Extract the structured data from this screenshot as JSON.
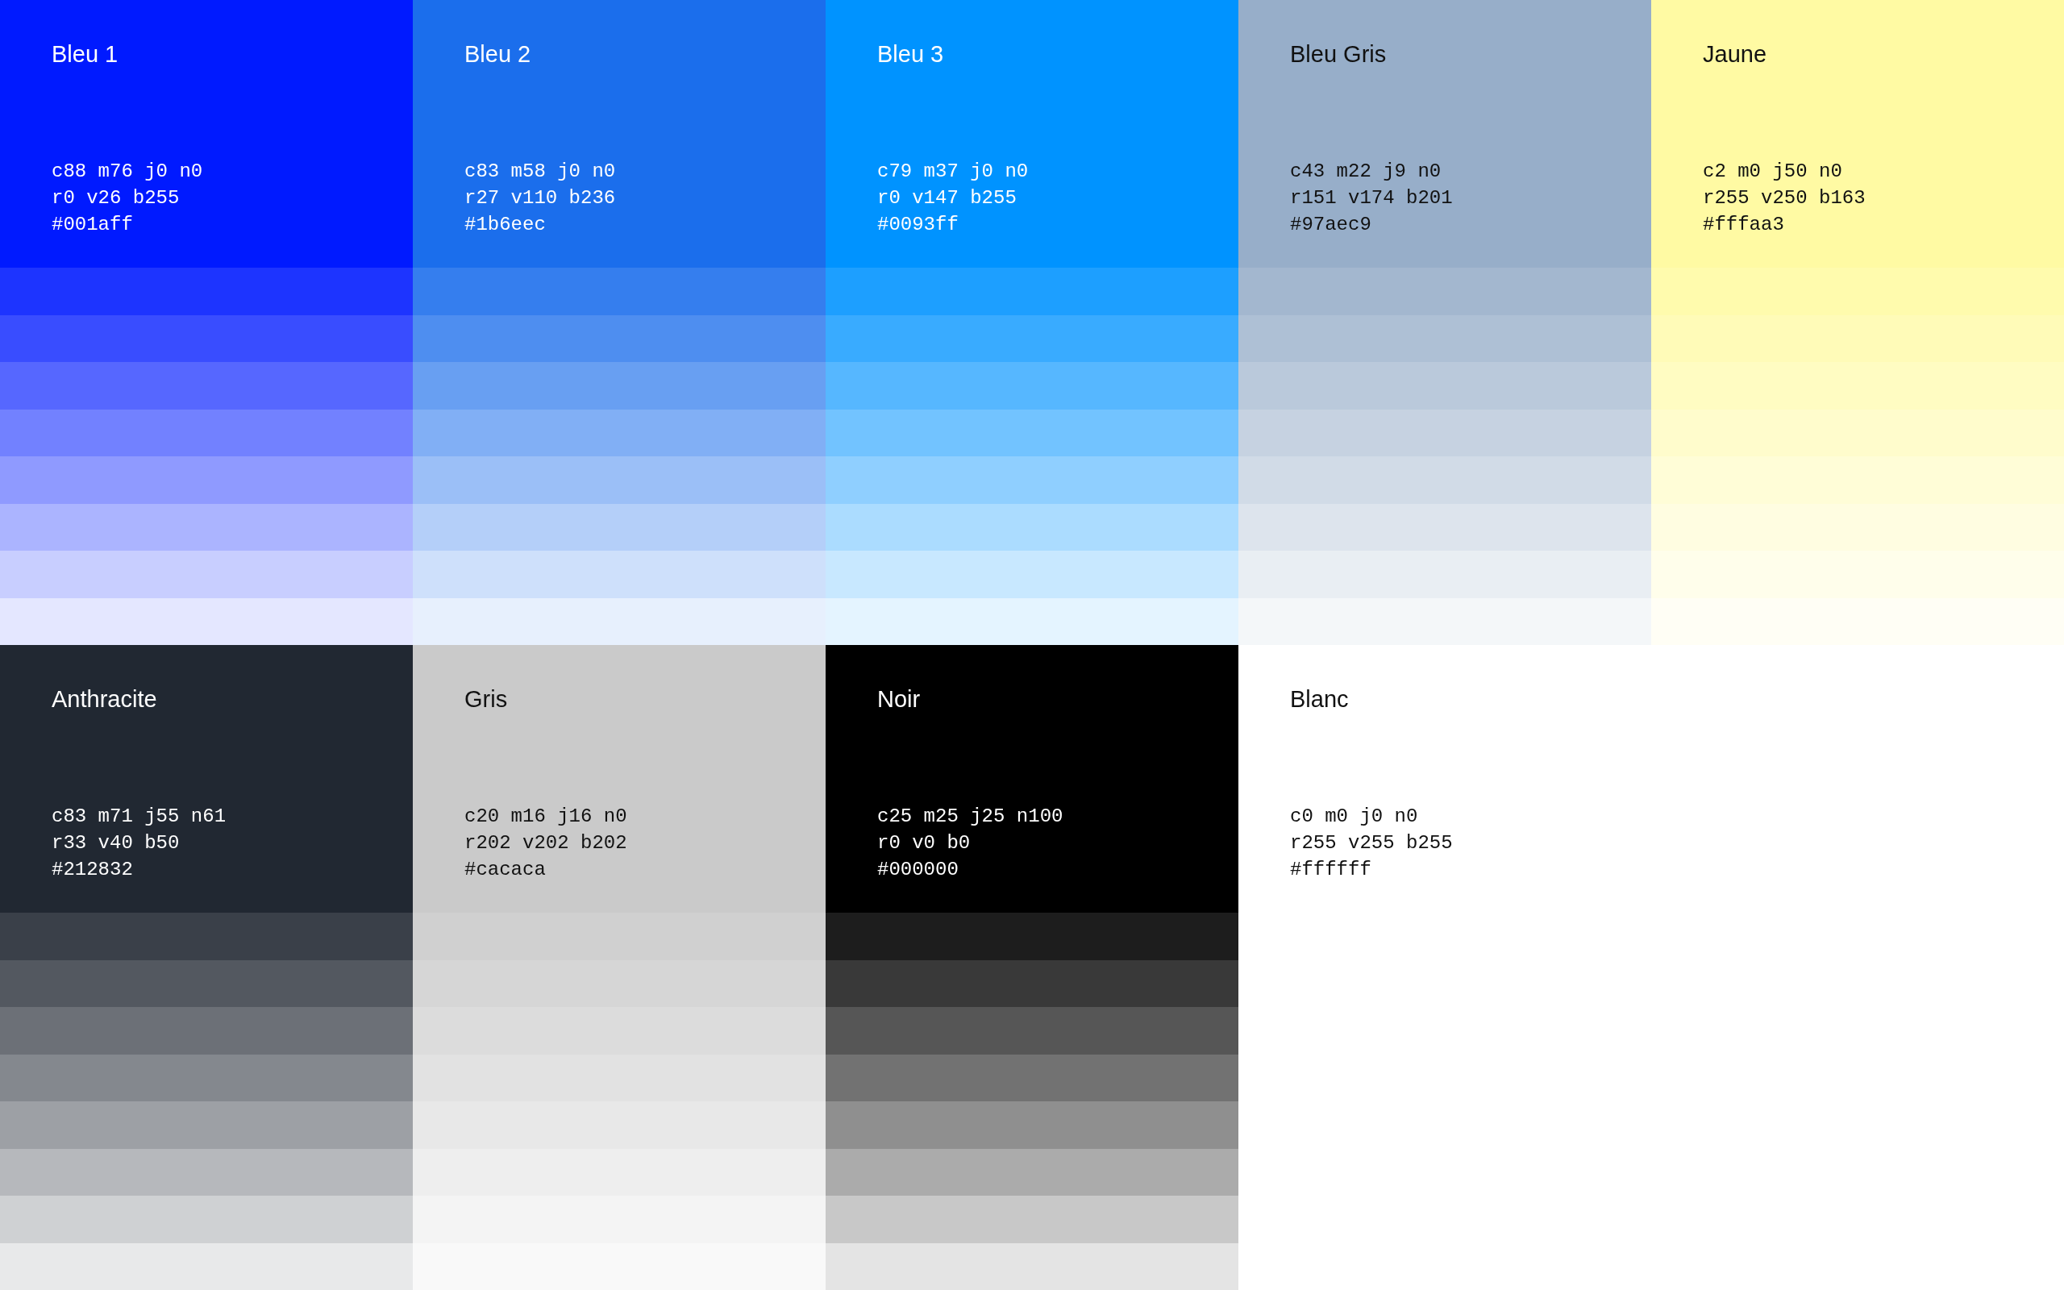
{
  "palette": {
    "rows": [
      [
        {
          "name": "Bleu 1",
          "color": "#001aff",
          "cmjn": "c88 m76 j0 n0",
          "rvb": "r0 v26 b255",
          "hex": "#001aff"
        },
        {
          "name": "Bleu 2",
          "color": "#1b6eec",
          "cmjn": "c83 m58 j0 n0",
          "rvb": "r27 v110 b236",
          "hex": "#1b6eec"
        },
        {
          "name": "Bleu 3",
          "color": "#0093ff",
          "cmjn": "c79 m37 j0 n0",
          "rvb": "r0 v147 b255",
          "hex": "#0093ff"
        },
        {
          "name": "Bleu Gris",
          "color": "#97aec9",
          "cmjn": "c43 m22 j9 n0",
          "rvb": "r151 v174 b201",
          "hex": "#97aec9"
        },
        {
          "name": "Jaune",
          "color": "#fffaa3",
          "cmjn": "c2 m0 j50 n0",
          "rvb": "r255 v250 b163",
          "hex": "#fffaa3"
        }
      ],
      [
        {
          "name": "Anthracite",
          "color": "#212832",
          "cmjn": "c83 m71 j55 n61",
          "rvb": "r33 v40 b50",
          "hex": "#212832"
        },
        {
          "name": "Gris",
          "color": "#cacaca",
          "cmjn": "c20 m16 j16 n0",
          "rvb": "r202 v202 b202",
          "hex": "#cacaca"
        },
        {
          "name": "Noir",
          "color": "#000000",
          "cmjn": "c25 m25 j25 n100",
          "rvb": "r0 v0 b0",
          "hex": "#000000"
        },
        {
          "name": "Blanc",
          "color": "#ffffff",
          "cmjn": "c0 m0 j0 n0",
          "rvb": "r255 v255 b255",
          "hex": "#ffffff"
        }
      ]
    ]
  }
}
